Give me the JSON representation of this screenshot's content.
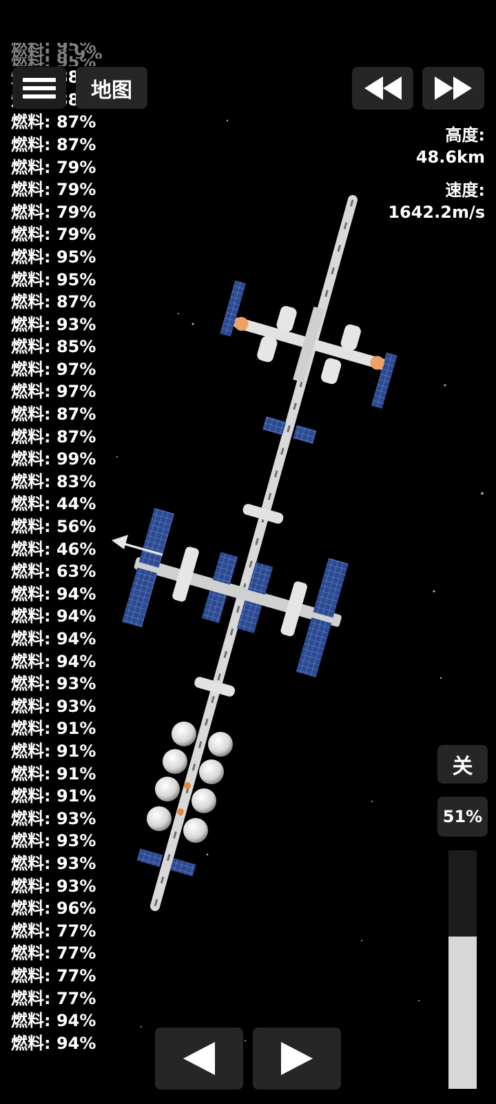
{
  "fuel": {
    "prefix": "燃料: ",
    "values": [
      "88%",
      "88%",
      "87%",
      "87%",
      "79%",
      "79%",
      "79%",
      "79%",
      "95%",
      "95%",
      "87%",
      "93%",
      "85%",
      "97%",
      "97%",
      "87%",
      "87%",
      "99%",
      "83%",
      "44%",
      "56%",
      "46%",
      "63%",
      "94%",
      "94%",
      "94%",
      "94%",
      "93%",
      "93%",
      "91%",
      "91%",
      "91%",
      "91%",
      "93%",
      "93%",
      "93%",
      "93%",
      "96%",
      "77%",
      "77%",
      "77%",
      "77%",
      "94%",
      "94%"
    ],
    "partial_top": [
      "燃料: 95%",
      "燃料: 8.9%",
      "燃料: 95%"
    ]
  },
  "toolbar": {
    "map_label": "地图"
  },
  "telemetry": {
    "altitude_label": "高度:",
    "altitude_value": "48.6km",
    "speed_label": "速度:",
    "speed_value": "1642.2m/s"
  },
  "controls": {
    "off_label": "关",
    "throttle_label": "51%",
    "throttle_fraction": 0.64
  },
  "icons": {
    "menu": "hamburger-icon",
    "rewind": "rewind-icon",
    "fast_forward": "fast-forward-icon",
    "rotate_left": "triangle-left-icon",
    "rotate_right": "triangle-right-icon"
  }
}
